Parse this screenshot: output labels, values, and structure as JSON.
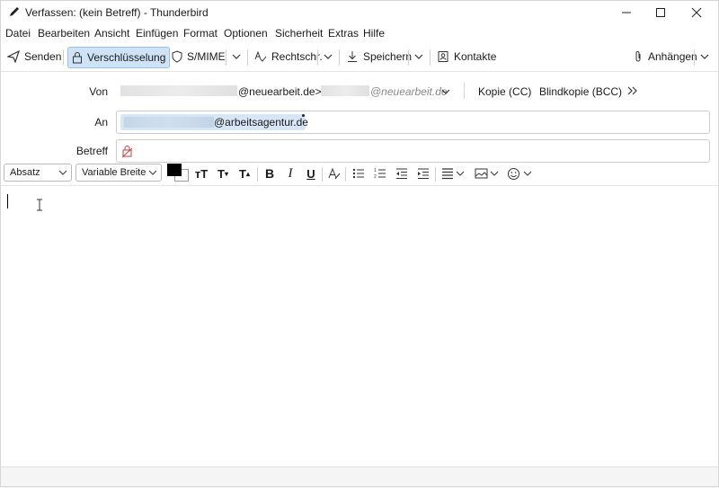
{
  "window": {
    "title": "Verfassen: (kein Betreff) - Thunderbird"
  },
  "menubar": {
    "items": [
      {
        "label": "Datei"
      },
      {
        "label": "Bearbeiten"
      },
      {
        "label": "Ansicht"
      },
      {
        "label": "Einfügen"
      },
      {
        "label": "Format"
      },
      {
        "label": "Optionen"
      },
      {
        "label": "Sicherheit"
      },
      {
        "label": "Extras"
      },
      {
        "label": "Hilfe"
      }
    ]
  },
  "toolbar": {
    "send": "Senden",
    "encryption": "Verschlüsselung",
    "smime": "S/MIME",
    "spelling": "Rechtschr.",
    "save": "Speichern",
    "contacts": "Kontakte",
    "attach": "Anhängen"
  },
  "header": {
    "from_label": "Von",
    "from_address_suffix": "@neuearbeit.de>",
    "from_identity_suffix": "@neuearbeit.de",
    "cc": "Kopie (CC)",
    "bcc": "Blindkopie (BCC)",
    "to_label": "An",
    "to_recipient_suffix": "@arbeitsagentur.de",
    "subject_label": "Betreff",
    "subject_value": ""
  },
  "format": {
    "paragraph": "Absatz",
    "font": "Variable Breite",
    "text_color": "#000000"
  },
  "icons": [
    "pen-icon",
    "send-icon",
    "lock-icon",
    "shield-icon",
    "spellcheck-icon",
    "download-icon",
    "contacts-icon",
    "paperclip-icon",
    "chevron-down-icon",
    "double-chevron-icon",
    "bold-icon",
    "italic-icon",
    "underline-icon",
    "bullet-list-icon",
    "numbered-list-icon",
    "outdent-icon",
    "indent-icon",
    "align-icon",
    "image-icon",
    "emoji-icon"
  ]
}
